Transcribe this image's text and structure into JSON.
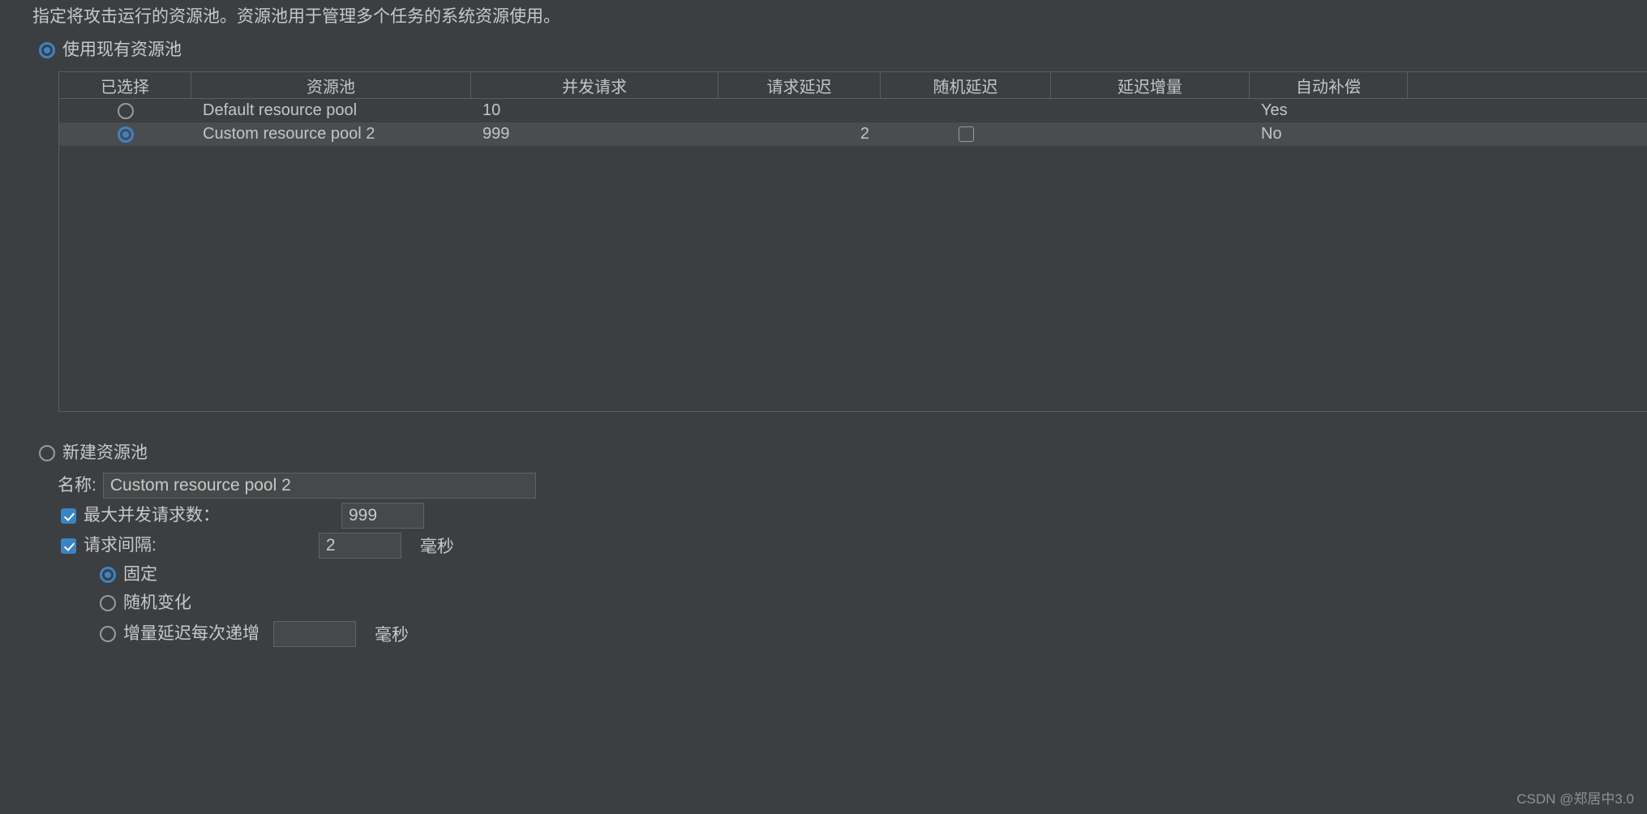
{
  "intro": {
    "description": "指定将攻击运行的资源池。资源池用于管理多个任务的系统资源使用。"
  },
  "mode_options": {
    "use_existing_label": "使用现有资源池",
    "use_existing_selected": true,
    "create_new_label": "新建资源池",
    "create_new_selected": false
  },
  "table": {
    "columns": [
      "已选择",
      "资源池",
      "并发请求",
      "请求延迟",
      "随机延迟",
      "延迟增量",
      "自动补偿",
      ""
    ],
    "rows": [
      {
        "selected": false,
        "pool": "Default resource pool",
        "concurrent": "10",
        "request_delay": "",
        "random_delay": "",
        "delay_increment": "",
        "auto_compensate": "Yes",
        "has_random_delay_checkbox": false,
        "random_delay_checked": false,
        "row_highlighted": false
      },
      {
        "selected": true,
        "pool": "Custom resource pool 2",
        "concurrent": "999",
        "request_delay": "2",
        "random_delay": "",
        "delay_increment": "",
        "auto_compensate": "No",
        "has_random_delay_checkbox": true,
        "random_delay_checked": false,
        "row_highlighted": true
      }
    ]
  },
  "new_pool_form": {
    "name_label": "名称:",
    "name_value": "Custom resource pool 2",
    "max_concurrent_label": "最大并发请求数：",
    "max_concurrent_checked": true,
    "max_concurrent_value": "999",
    "interval_label": "请求间隔:",
    "interval_checked": true,
    "interval_value": "2",
    "interval_unit": "毫秒",
    "delay_mode_options": [
      {
        "label": "固定",
        "selected": true
      },
      {
        "label": "随机变化",
        "selected": false
      },
      {
        "label": "增量延迟每次递增",
        "selected": false
      }
    ],
    "incremental_value": "",
    "incremental_unit": "毫秒"
  },
  "watermark": {
    "text": "CSDN @郑居中3.0"
  }
}
